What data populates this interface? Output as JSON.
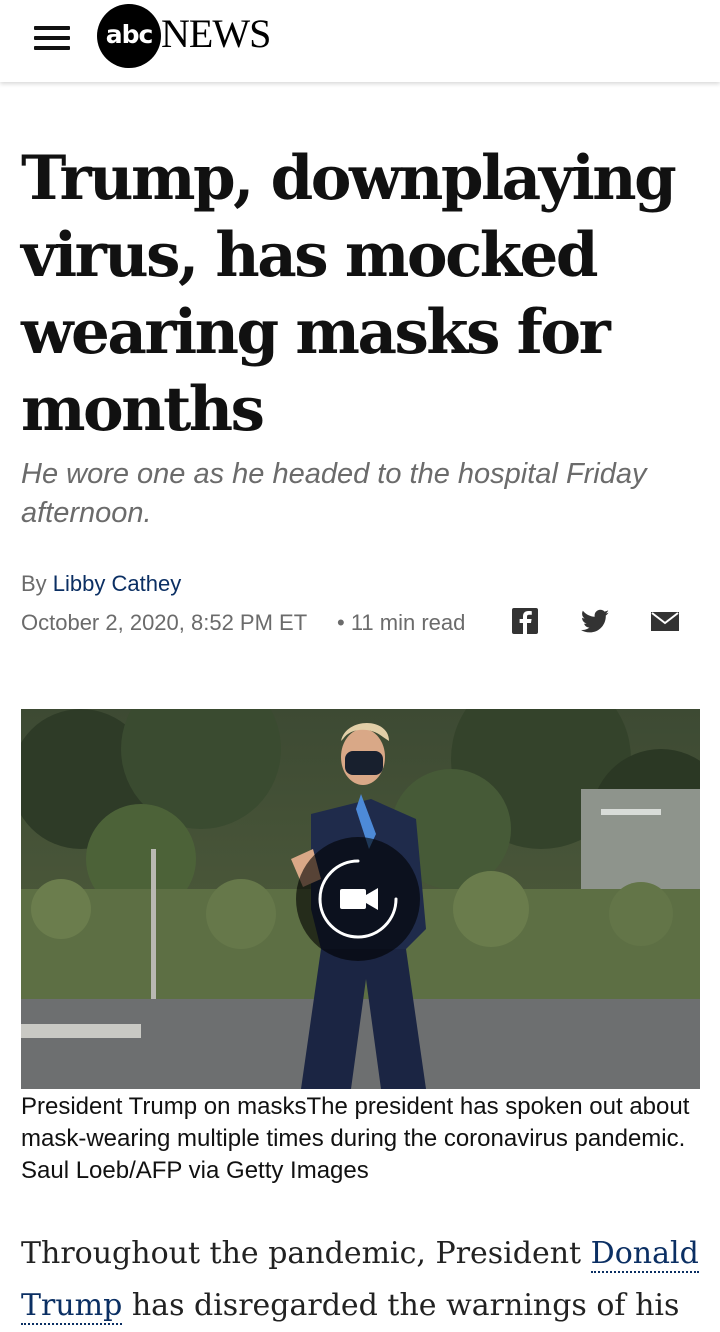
{
  "header": {
    "menu_icon": "hamburger-menu-icon",
    "logo_abc": "abc",
    "logo_news": "NEWS"
  },
  "article": {
    "headline": "Trump, downplaying virus, has mocked wearing masks for months",
    "subheadline": "He wore one as he headed to the hospital Friday afternoon.",
    "byline_prefix": "By ",
    "author": "Libby Cathey",
    "date": "October 2, 2020, 8:52 PM ET",
    "read_time": "• 11 min read",
    "share_icons": [
      "facebook-icon",
      "twitter-icon",
      "email-icon"
    ],
    "image_caption": "President Trump on masksThe president has spoken out about mask-wearing multiple times during the coronavirus pandemic. Saul Loeb/AFP via Getty Images",
    "video_icon": "video-camera-icon",
    "body_start": "Throughout the pandemic, President ",
    "body_link": "Donald Trump",
    "body_rest": " has disregarded the warnings of his"
  },
  "colors": {
    "link": "#0b2f63",
    "muted": "#6b6b6b",
    "headline": "#111111"
  }
}
